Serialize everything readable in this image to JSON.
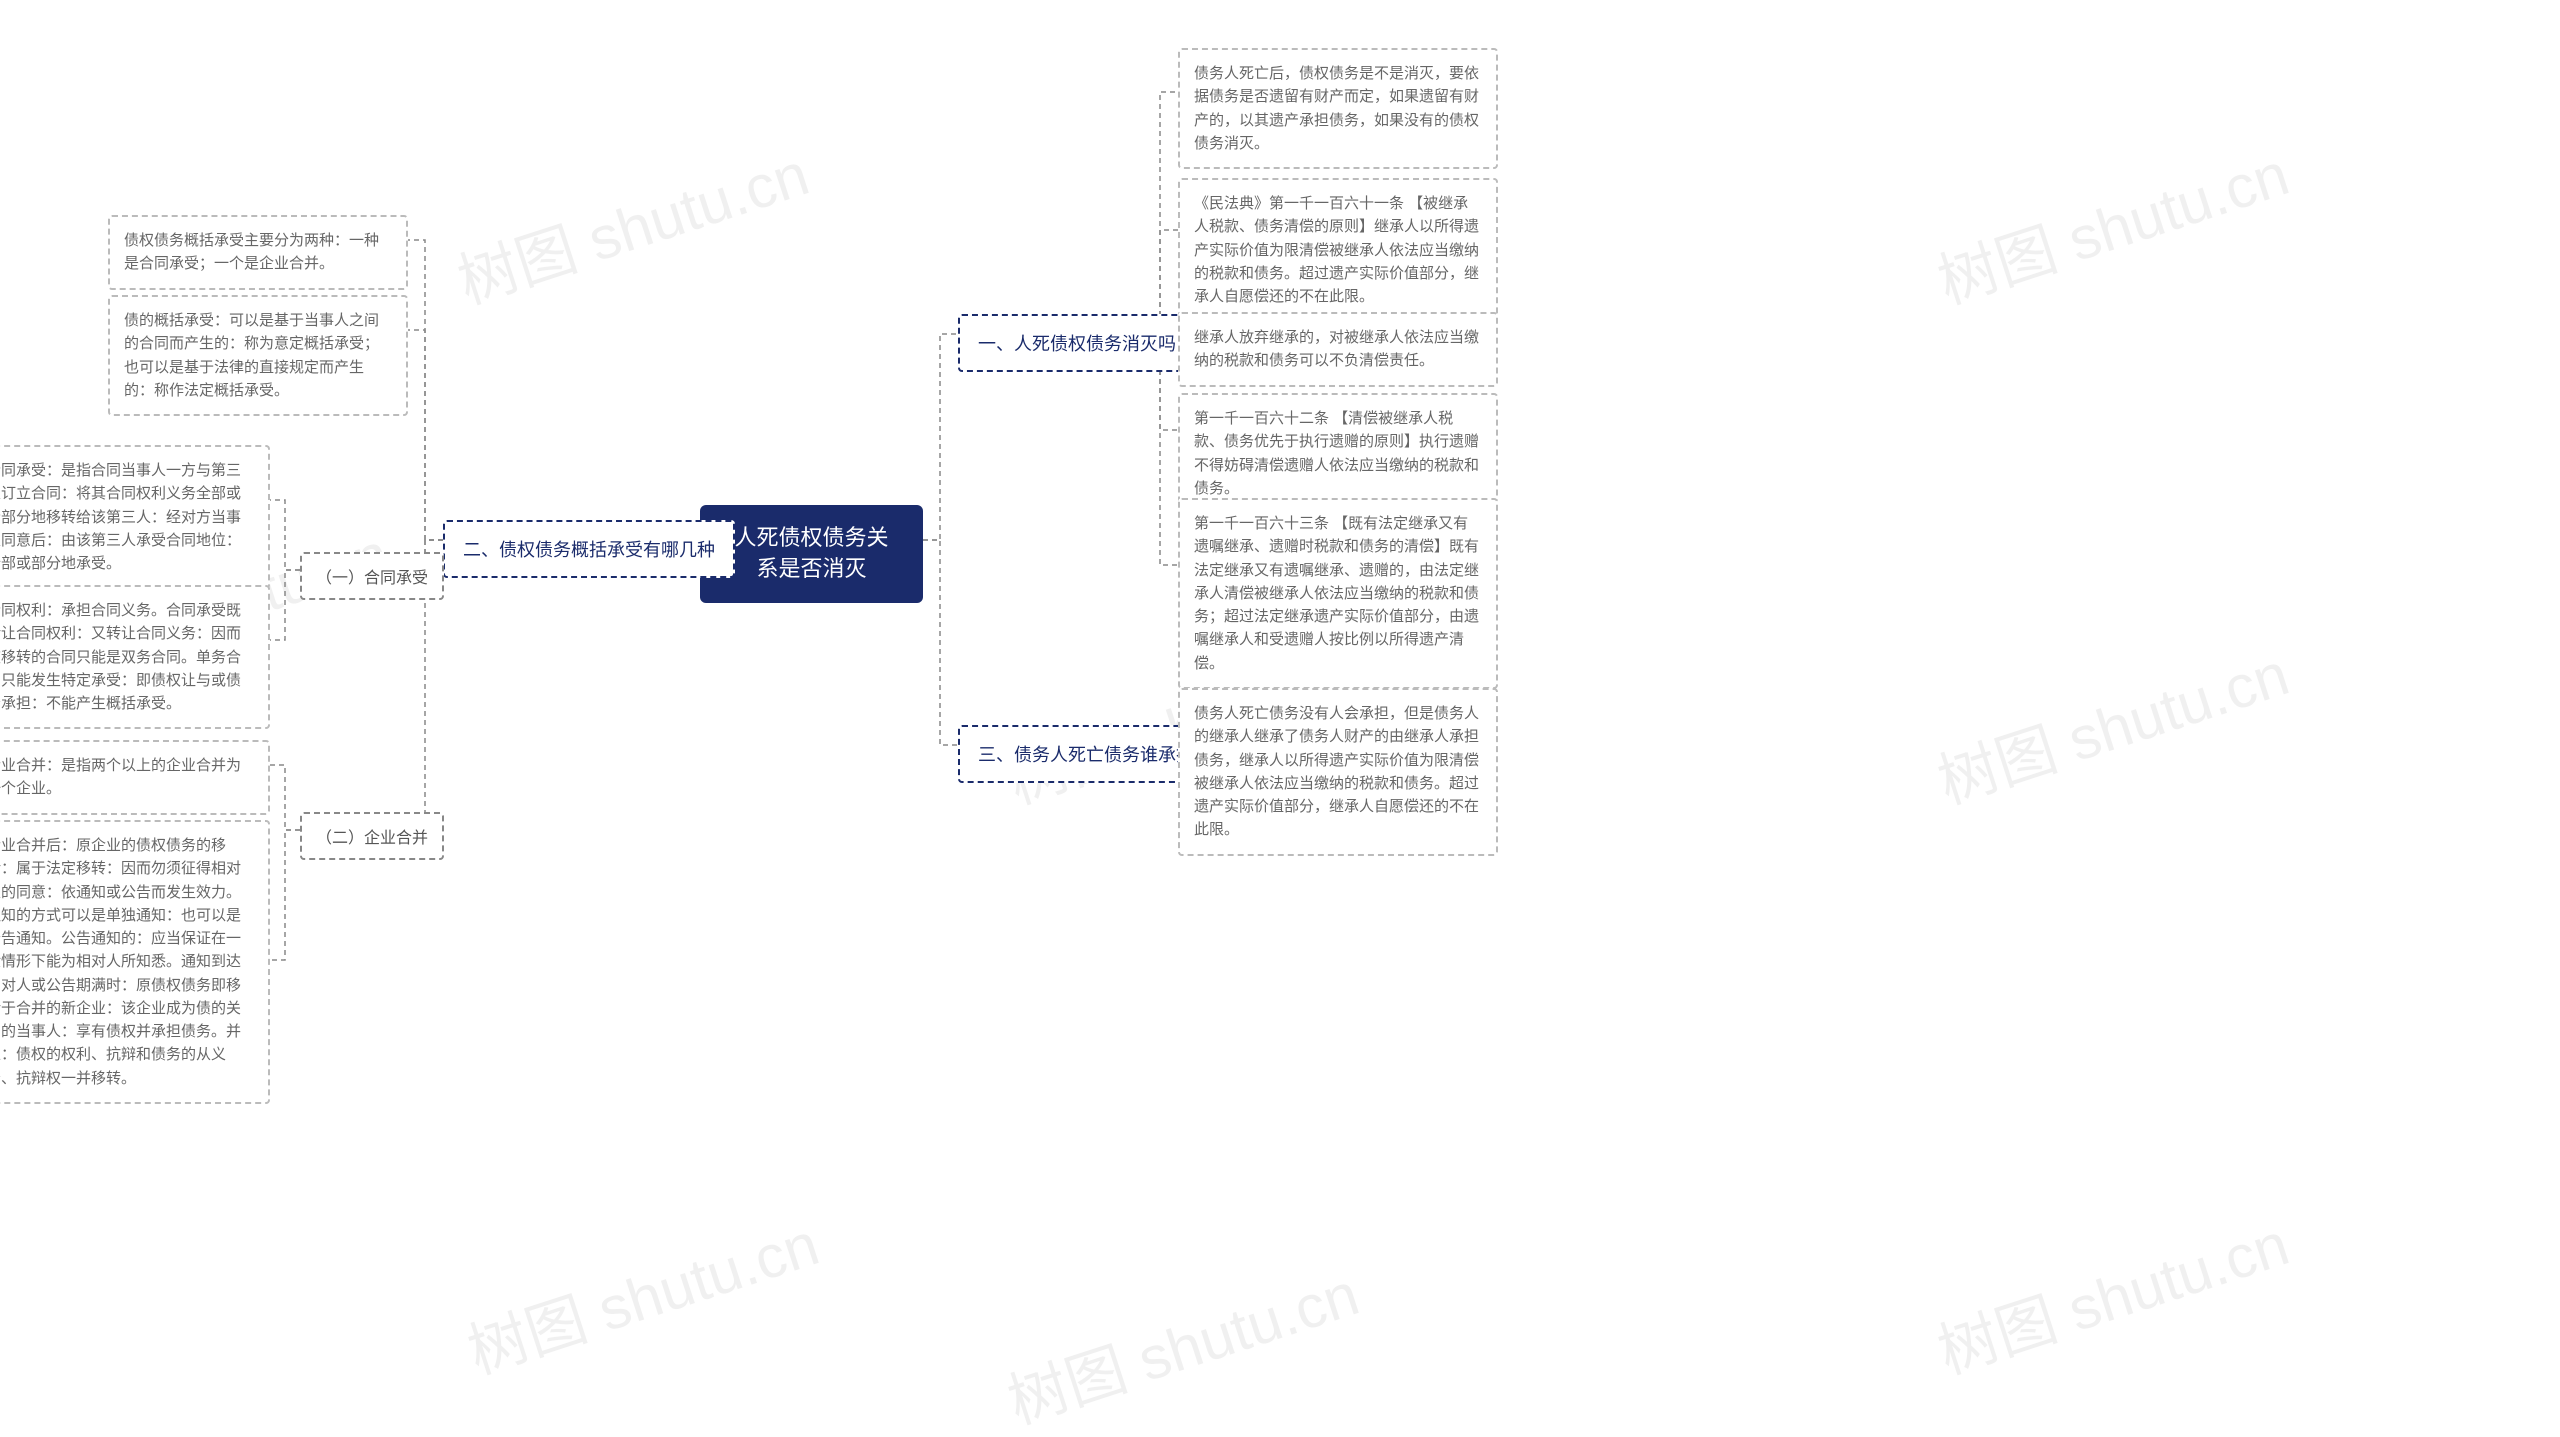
{
  "root": {
    "title": "人死债权债务关系是否消灭"
  },
  "branches": {
    "b1": {
      "label": "一、人死债权债务消灭吗"
    },
    "b2": {
      "label": "二、债权债务概括承受有哪几种"
    },
    "b3": {
      "label": "三、债务人死亡债务谁承担"
    }
  },
  "subs": {
    "s1": {
      "label": "（一）合同承受"
    },
    "s2": {
      "label": "（二）企业合并"
    }
  },
  "leaves": {
    "r1a": "债务人死亡后，债权债务是不是消灭，要依据债务是否遗留有财产而定，如果遗留有财产的，以其遗产承担债务，如果没有的债权债务消灭。",
    "r1b": "《民法典》第一千一百六十一条 【被继承人税款、债务清偿的原则】继承人以所得遗产实际价值为限清偿被继承人依法应当缴纳的税款和债务。超过遗产实际价值部分，继承人自愿偿还的不在此限。",
    "r1c": "继承人放弃继承的，对被继承人依法应当缴纳的税款和债务可以不负清偿责任。",
    "r1d": "第一千一百六十二条 【清偿被继承人税款、债务优先于执行遗赠的原则】执行遗赠不得妨碍清偿遗赠人依法应当缴纳的税款和债务。",
    "r1e": "第一千一百六十三条 【既有法定继承又有遗嘱继承、遗赠时税款和债务的清偿】既有法定继承又有遗嘱继承、遗赠的，由法定继承人清偿被继承人依法应当缴纳的税款和债务；超过法定继承遗产实际价值部分，由遗嘱继承人和受遗赠人按比例以所得遗产清偿。",
    "r3a": "债务人死亡债务没有人会承担，但是债务人的继承人继承了债务人财产的由继承人承担债务，继承人以所得遗产实际价值为限清偿被继承人依法应当缴纳的税款和债务。超过遗产实际价值部分，继承人自愿偿还的不在此限。",
    "l2a": "债权债务概括承受主要分为两种：一种是合同承受；一个是企业合并。",
    "l2b": "债的概括承受：可以是基于当事人之间的合同而产生的：称为意定概括承受；也可以是基于法律的直接规定而产生的：称作法定概括承受。",
    "l2s1a": "合同承受：是指合同当事人一方与第三人订立合同：将其合同权利义务全部或者部分地移转给该第三人：经对方当事人同意后：由该第三人承受合同地位：全部或部分地承受。",
    "l2s1b": "合同权利：承担合同义务。合同承受既转让合同权利：又转让合同义务：因而被移转的合同只能是双务合同。单务合同只能发生特定承受：即债权让与或债务承担：不能产生概括承受。",
    "l2s2a": "企业合并：是指两个以上的企业合并为一个企业。",
    "l2s2b": "企业合并后：原企业的债权债务的移转：属于法定移转：因而勿须征得相对人的同意：依通知或公告而发生效力。通知的方式可以是单独通知：也可以是公告通知。公告通知的：应当保证在一般情形下能为相对人所知悉。通知到达相对人或公告期满时：原债权债务即移转于合并的新企业：该企业成为债的关系的当事人：享有债权并承担债务。并且：债权的权利、抗辩和债务的从义务、抗辩权一并移转。"
  },
  "watermark": "树图 shutu.cn"
}
